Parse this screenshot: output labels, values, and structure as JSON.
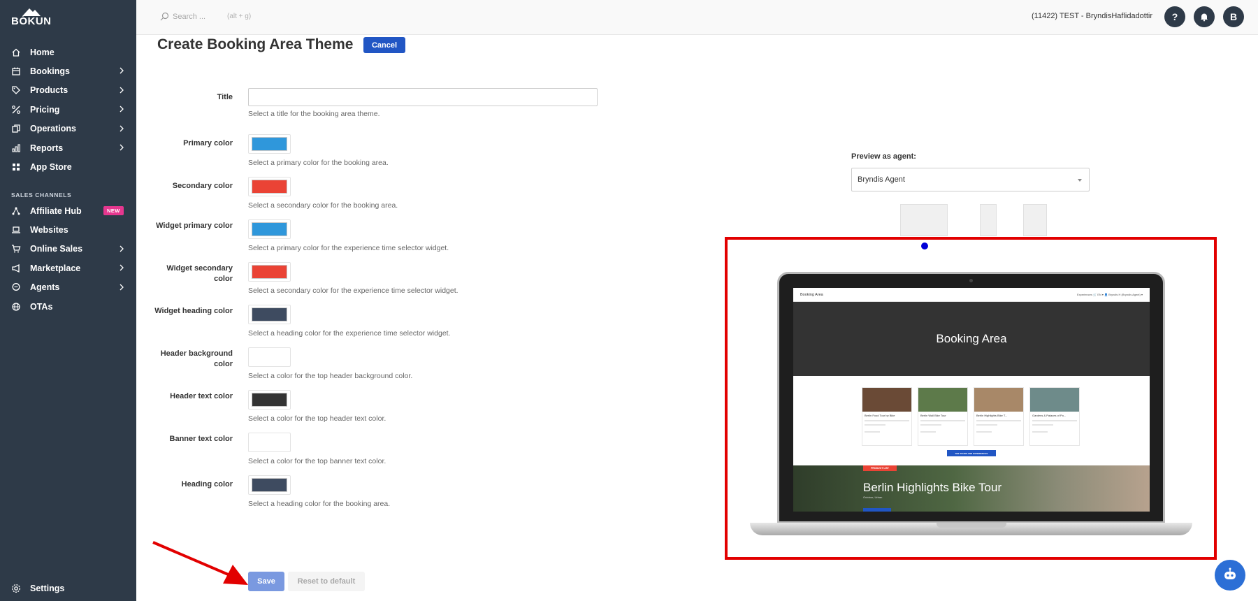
{
  "brand": {
    "logo_text": "BÓKUN"
  },
  "topbar": {
    "search_placeholder": "Search ...",
    "search_hint": "(alt + g)",
    "account": "(11422) TEST - BryndisHaflidadottir",
    "help_label": "?",
    "avatar_initial": "B"
  },
  "sidebar": {
    "items": [
      {
        "label": "Home",
        "icon": "home-icon",
        "chevron": false
      },
      {
        "label": "Bookings",
        "icon": "calendar-icon",
        "chevron": true
      },
      {
        "label": "Products",
        "icon": "tag-icon",
        "chevron": true
      },
      {
        "label": "Pricing",
        "icon": "percent-icon",
        "chevron": true
      },
      {
        "label": "Operations",
        "icon": "copy-icon",
        "chevron": true
      },
      {
        "label": "Reports",
        "icon": "bar-chart-icon",
        "chevron": true
      },
      {
        "label": "App Store",
        "icon": "grid-icon",
        "chevron": false
      }
    ],
    "section_label": "SALES CHANNELS",
    "channels": [
      {
        "label": "Affiliate Hub",
        "icon": "network-icon",
        "badge": "NEW",
        "chevron": false
      },
      {
        "label": "Websites",
        "icon": "laptop-icon",
        "chevron": false
      },
      {
        "label": "Online Sales",
        "icon": "cart-icon",
        "chevron": true
      },
      {
        "label": "Marketplace",
        "icon": "megaphone-icon",
        "chevron": true
      },
      {
        "label": "Agents",
        "icon": "chat-icon",
        "chevron": true
      },
      {
        "label": "OTAs",
        "icon": "globe-icon",
        "chevron": false
      }
    ],
    "settings_label": "Settings"
  },
  "header": {
    "title": "Create Booking Area Theme",
    "cancel_label": "Cancel"
  },
  "form": {
    "title_label": "Title",
    "title_value": "",
    "title_help": "Select a title for the booking area theme.",
    "colors": [
      {
        "label": "Primary color",
        "color": "#2f97db",
        "help": "Select a primary color for the booking area."
      },
      {
        "label": "Secondary color",
        "color": "#ea4335",
        "help": "Select a secondary color for the booking area."
      },
      {
        "label": "Widget primary color",
        "color": "#2f97db",
        "help": "Select a primary color for the experience time selector widget."
      },
      {
        "label": "Widget secondary color",
        "color": "#ea4335",
        "help": "Select a secondary color for the experience time selector widget."
      },
      {
        "label": "Widget heading color",
        "color": "#3e4b60",
        "help": "Select a heading color for the experience time selector widget."
      },
      {
        "label": "Header background color",
        "color": "#ffffff",
        "help": "Select a color for the top header background color."
      },
      {
        "label": "Header text color",
        "color": "#333333",
        "help": "Select a color for the top header text color."
      },
      {
        "label": "Banner text color",
        "color": "#ffffff",
        "help": "Select a color for the top banner text color."
      },
      {
        "label": "Heading color",
        "color": "#3e4b60",
        "help": "Select a heading color for the booking area."
      }
    ],
    "save_label": "Save",
    "reset_label": "Reset to default"
  },
  "preview": {
    "label": "Preview as agent:",
    "agent_selected": "Bryndis Agent",
    "screen": {
      "brand": "Booking Area",
      "nav_right": "Experiences   🛒   EN ▾   👤 Bryndis H (Bryndis Agent) ▾",
      "hero_title": "Booking Area",
      "cards": [
        {
          "title": "Berlin Food Tour by Bike",
          "color": "#6a4a36"
        },
        {
          "title": "Berlin Wall Bike Tour",
          "color": "#5d7a4a"
        },
        {
          "title": "Berlin Highlights Bike T...",
          "color": "#a88868"
        },
        {
          "title": "Gardens & Palaces of Po...",
          "color": "#6e8b8a"
        }
      ],
      "all_button": "SEE TOURS AND EXPERIENCES",
      "banner_tag": "PRODUCT LIST",
      "banner_title": "Berlin Highlights Bike Tour",
      "banner_sub": "Outdoor, Urban"
    }
  },
  "colors": {
    "sidebar_bg": "#2e3a48",
    "accent": "#2156c4",
    "annotation_red": "#e20000"
  }
}
